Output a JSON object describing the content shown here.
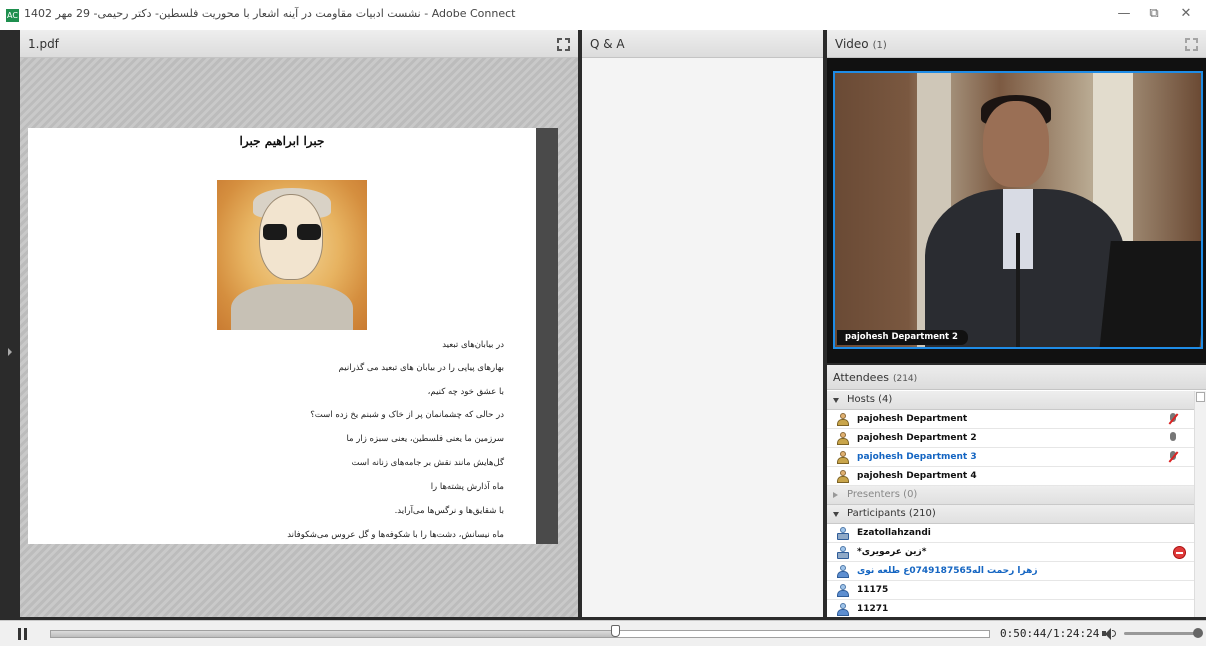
{
  "window": {
    "app_icon_text": "AC",
    "title": "نشست ادبیات مقاومت در آینه اشعار با محوریت فلسطین- دکتر رحیمی- 29 مهر 1402 - Adobe Connect",
    "buttons": {
      "minimize": "—",
      "restore": "⧉",
      "close": "✕"
    }
  },
  "pdf_pod": {
    "title": "1.pdf",
    "heading": "جبرا ابراهیم جبرا",
    "poem_lines": [
      "در بیابان‌های تبعید",
      "بهارهای پیاپی را در بیابان های تبعید می گذرانیم",
      "با عشق خود چه کنیم،",
      "در حالی که چشمانمان پر از خاک و شبنم یخ زده است؟",
      "سرزمین ما یعنی فلسطین، یعنی سبزه زار ما",
      "گل‌هایش مانند نقش بر جامه‌های زنانه است",
      "ماه آذارش پشته‌ها را",
      "با شقایق‌ها و نرگس‌ها می‌آراید.",
      "ماه نیسانش، دشت‌ها را با شکوفه‌ها و گل عروس می‌شکوفاند"
    ]
  },
  "qa_pod": {
    "title": "Q & A"
  },
  "video_pod": {
    "title": "Video",
    "count": "(1)",
    "speaker_label": "pajohesh Department 2",
    "accent": "#1f8ce6"
  },
  "attendees_pod": {
    "title": "Attendees",
    "count": "(214)",
    "groups": {
      "hosts": "Hosts (4)",
      "presenters": "Presenters (0)",
      "participants": "Participants (210)"
    },
    "hosts": [
      {
        "name": "pajohesh Department",
        "status": "mic-off-icon"
      },
      {
        "name": "pajohesh Department 2",
        "status": "mic-on-icon"
      },
      {
        "name": "pajohesh Department 3",
        "status": "mic-off-icon"
      },
      {
        "name": "pajohesh Department 4",
        "status": ""
      }
    ],
    "participants": [
      {
        "name": "Ezatollahzandi",
        "status": ""
      },
      {
        "name": "*زین عرمویری*",
        "status": "blocked-icon"
      },
      {
        "name": "زهرا رحمت اله0749187565ع طلعه نوی",
        "status": ""
      },
      {
        "name": "11175",
        "status": ""
      },
      {
        "name": "11271",
        "status": ""
      }
    ]
  },
  "playback": {
    "time": "0:50:44/1:24:24",
    "progress_fraction": 0.601,
    "volume_fraction": 1.0
  }
}
